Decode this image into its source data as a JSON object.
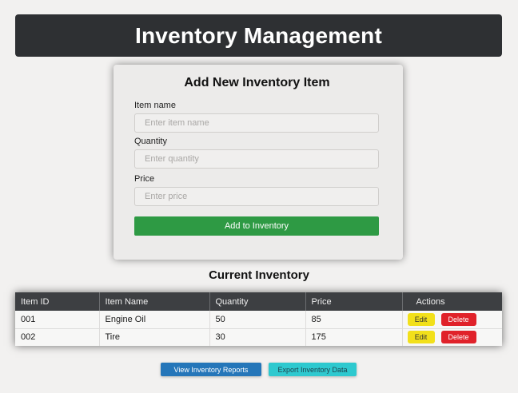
{
  "header": {
    "title": "Inventory Management"
  },
  "form": {
    "title": "Add New Inventory Item",
    "item_name_label": "Item name",
    "item_name_placeholder": "Enter item name",
    "quantity_label": "Quantity",
    "quantity_placeholder": "Enter quantity",
    "price_label": "Price",
    "price_placeholder": "Enter price",
    "submit_label": "Add to Inventory"
  },
  "inventory": {
    "title": "Current Inventory",
    "columns": [
      "Item ID",
      "Item Name",
      "Quantity",
      "Price",
      "Actions"
    ],
    "rows": [
      {
        "id": "001",
        "name": "Engine Oil",
        "quantity": "50",
        "price": "85"
      },
      {
        "id": "002",
        "name": "Tire",
        "quantity": "30",
        "price": "175"
      }
    ],
    "edit_label": "Edit",
    "delete_label": "Delete"
  },
  "footer_actions": {
    "reports_label": "View Inventory Reports",
    "export_label": "Export Inventory Data"
  },
  "colors": {
    "header_bg": "#2e3033",
    "primary_green": "#2e9a44",
    "edit_yellow": "#f2e01a",
    "delete_red": "#e0222a",
    "reports_blue": "#2576b9",
    "export_cyan": "#2ec9cf"
  }
}
